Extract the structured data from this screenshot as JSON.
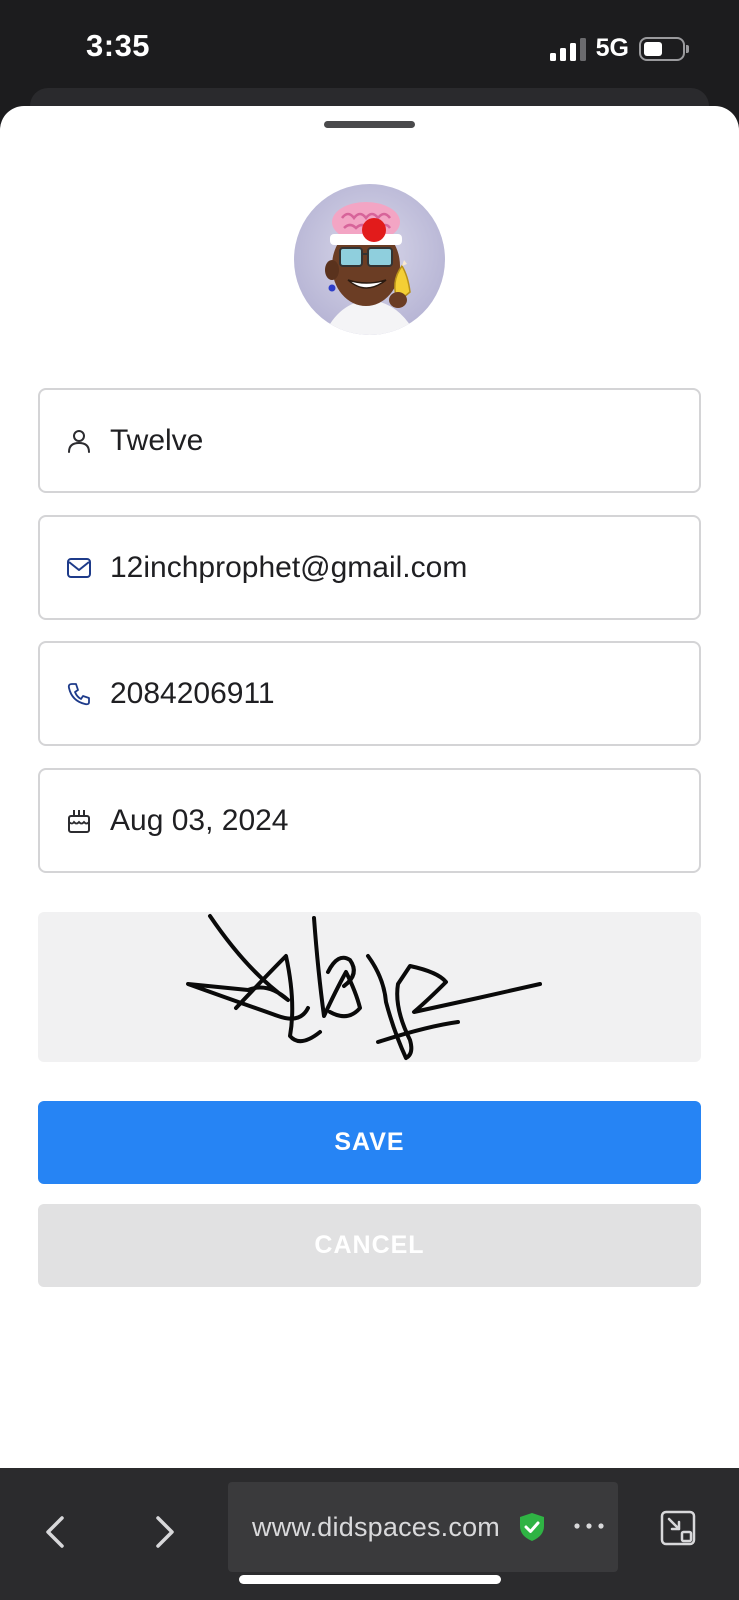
{
  "status_bar": {
    "time": "3:35",
    "network": "5G",
    "signal_bars_active": 3,
    "signal_bars_total": 4,
    "battery_level": 0.4
  },
  "profile": {
    "avatar_icon": "avatar-cartoon-icon",
    "fields": {
      "name": {
        "icon": "user-icon",
        "value": "Twelve"
      },
      "email": {
        "icon": "mail-icon",
        "value": "12inchprophet@gmail.com"
      },
      "phone": {
        "icon": "phone-icon",
        "value": "2084206911"
      },
      "birthday": {
        "icon": "cake-icon",
        "value": "Aug 03, 2024"
      }
    },
    "signature_icon": "signature-image"
  },
  "actions": {
    "save_label": "SAVE",
    "cancel_label": "CANCEL"
  },
  "browser": {
    "url": "www.didspaces.com",
    "secure_icon": "shield-check-icon",
    "back_icon": "chevron-left-icon",
    "forward_icon": "chevron-right-icon",
    "more_icon": "more-dots-icon",
    "minimize_icon": "picture-in-picture-icon"
  },
  "colors": {
    "primary": "#2684f4",
    "cancel_bg": "#e1e1e2",
    "secure_green": "#2fb344",
    "browser_bar": "#2b2b2d"
  }
}
